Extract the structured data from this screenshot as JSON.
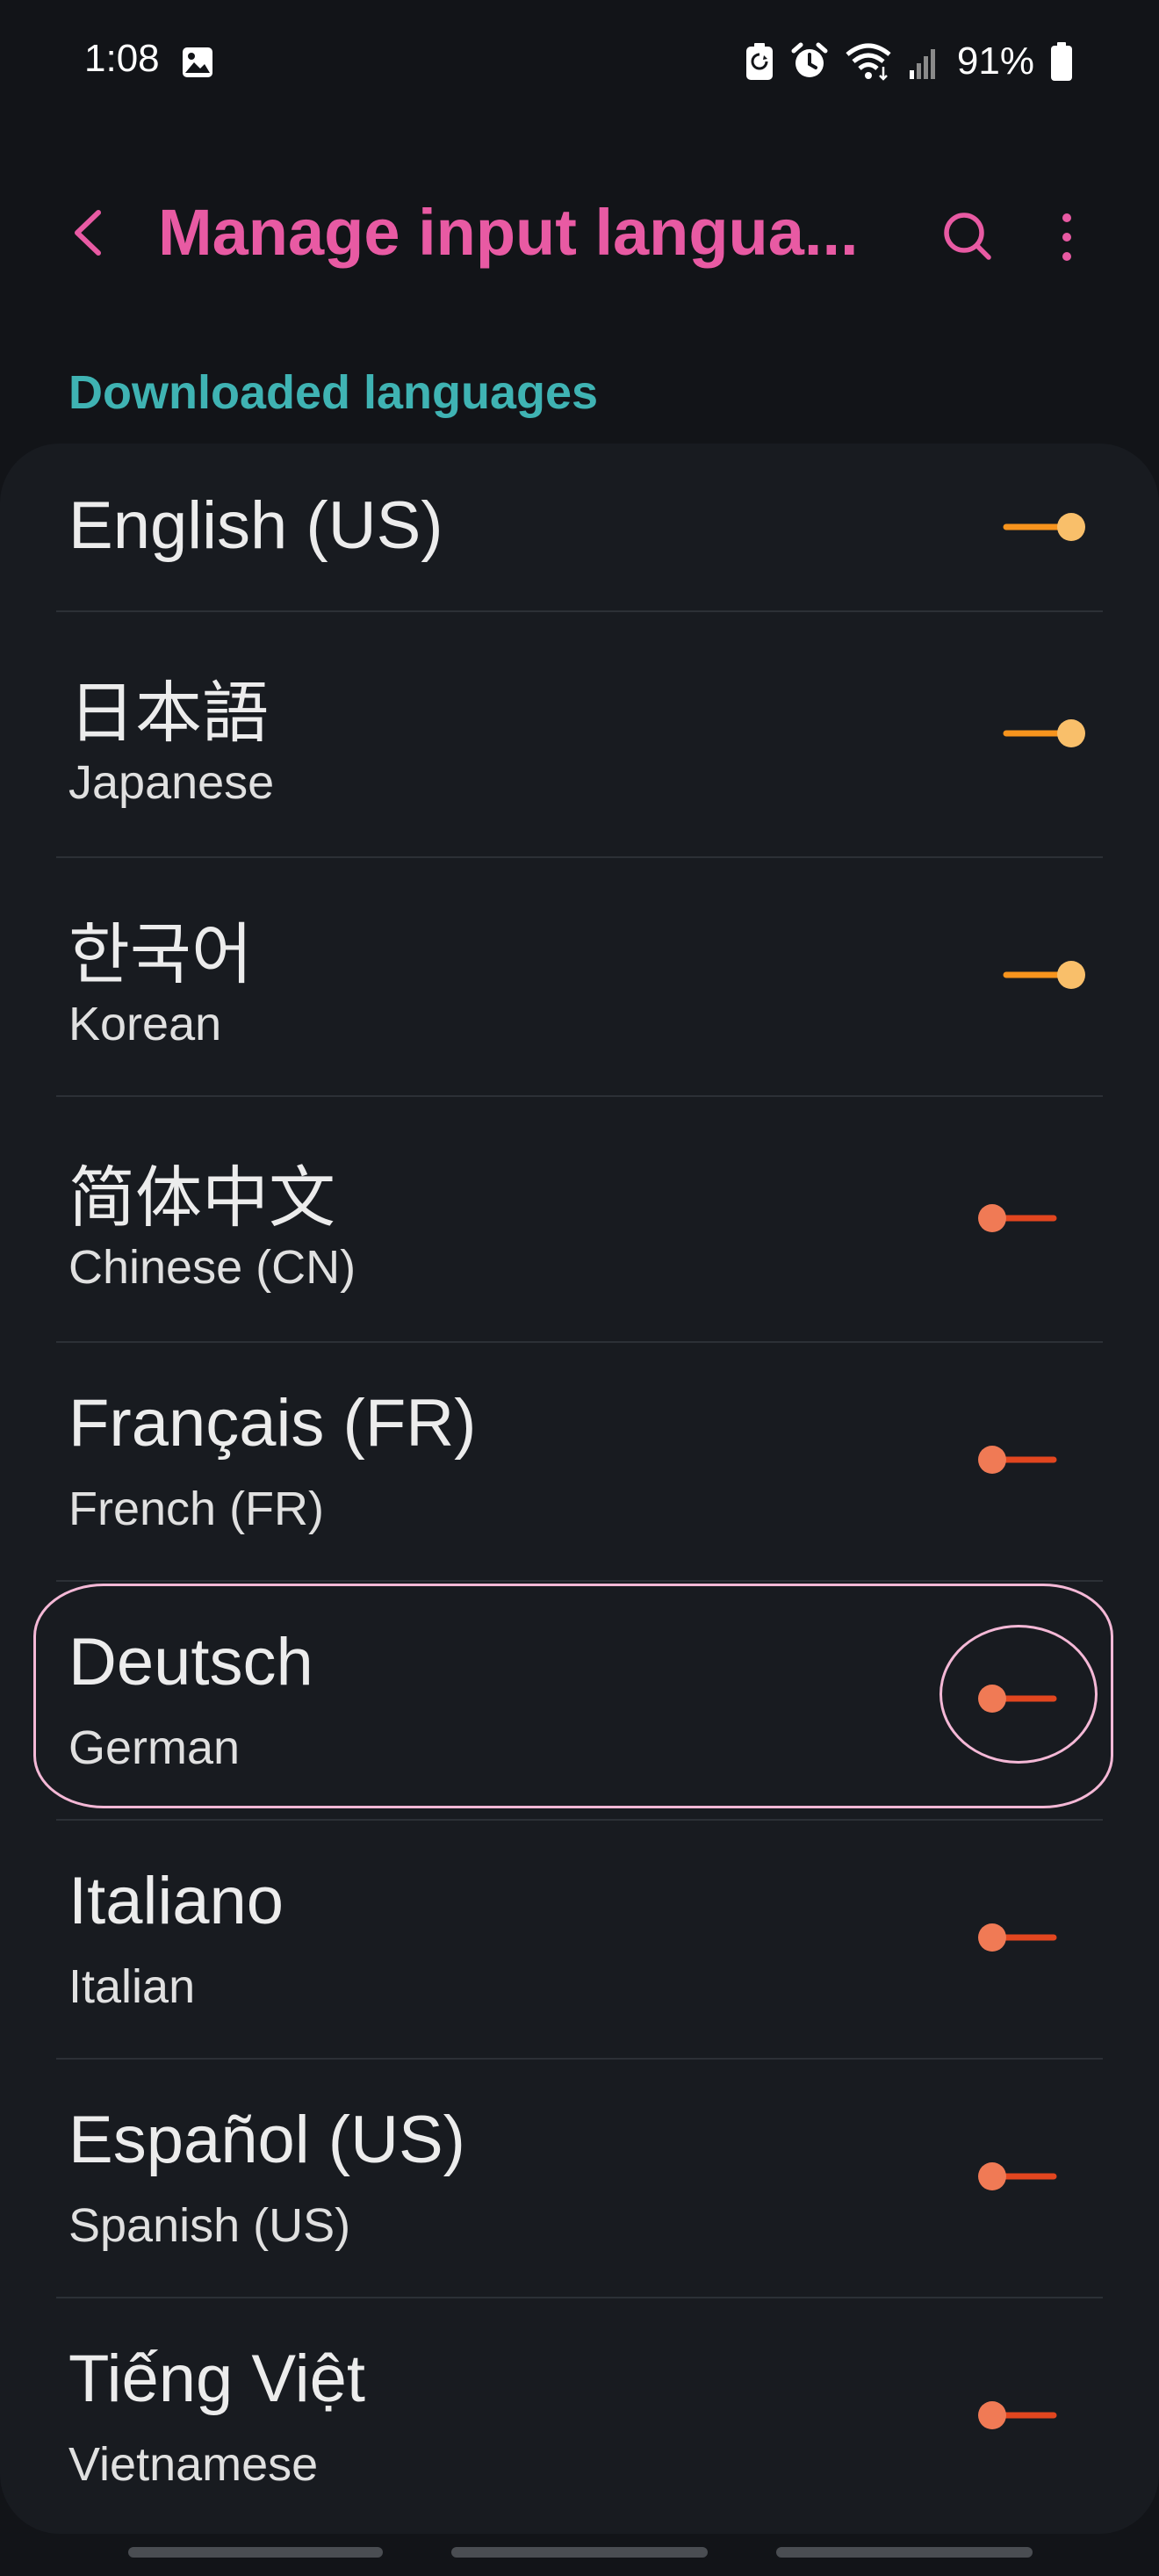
{
  "status_bar": {
    "time": "1:08",
    "battery_percent": "91%"
  },
  "app_bar": {
    "title": "Manage input langua..."
  },
  "section": {
    "title": "Downloaded languages"
  },
  "languages": [
    {
      "name": "English (US)",
      "subtitle": "",
      "enabled": true
    },
    {
      "name": "日本語",
      "subtitle": "Japanese",
      "enabled": true
    },
    {
      "name": "한국어",
      "subtitle": "Korean",
      "enabled": true
    },
    {
      "name": "简体中文",
      "subtitle": "Chinese (CN)",
      "enabled": false
    },
    {
      "name": "Français (FR)",
      "subtitle": "French (FR)",
      "enabled": false
    },
    {
      "name": "Deutsch",
      "subtitle": "German",
      "enabled": false
    },
    {
      "name": "Italiano",
      "subtitle": "Italian",
      "enabled": false
    },
    {
      "name": "Español (US)",
      "subtitle": "Spanish (US)",
      "enabled": false
    },
    {
      "name": "Tiếng Việt",
      "subtitle": "Vietnamese",
      "enabled": false
    }
  ],
  "colors": {
    "accent_title": "#e85aa3",
    "section_title": "#3fb3b3",
    "toggle_on": "#f7941d",
    "toggle_on_thumb": "#f9bf6a",
    "toggle_off": "#e2461f",
    "toggle_off_thumb": "#f07a55",
    "highlight": "#f4b8d6"
  },
  "icons": {
    "back": "chevron-left-icon",
    "search": "search-icon",
    "more": "more-vertical-icon",
    "gallery": "image-icon",
    "battery_saver": "battery-saver-icon",
    "alarm": "alarm-icon",
    "wifi": "wifi-icon",
    "signal": "signal-icon",
    "battery": "battery-icon"
  }
}
